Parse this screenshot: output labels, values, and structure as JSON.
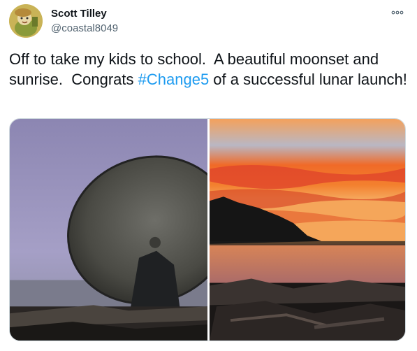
{
  "tweet": {
    "author": {
      "name": "Scott Tilley",
      "handle": "@coastal8049"
    },
    "text_before": "Off to take my kids to school.  A beautiful moonset and sunrise.  Congrats ",
    "hashtag": "#Change5",
    "text_after": " of a successful lunar launch!",
    "colors": {
      "text": "#0f1419",
      "secondary": "#536471",
      "link": "#1d9bf0"
    },
    "more_icon": "more-options-icon",
    "photos": [
      {
        "description_icon": "satellite-dish-photo"
      },
      {
        "description_icon": "sunrise-photo"
      }
    ]
  }
}
